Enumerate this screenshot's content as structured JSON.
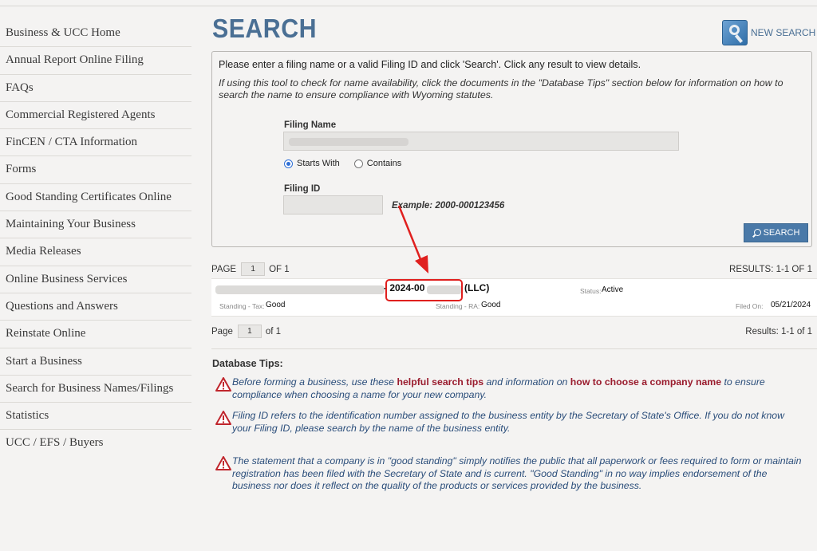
{
  "sidebar": {
    "items": [
      {
        "label": "Business & UCC Home"
      },
      {
        "label": "Annual Report Online Filing"
      },
      {
        "label": "FAQs"
      },
      {
        "label": "Commercial Registered Agents"
      },
      {
        "label": "FinCEN / CTA Information"
      },
      {
        "label": "Forms"
      },
      {
        "label": "Good Standing Certificates Online"
      },
      {
        "label": "Maintaining Your Business"
      },
      {
        "label": "Media Releases"
      },
      {
        "label": "Online Business Services"
      },
      {
        "label": "Questions and Answers"
      },
      {
        "label": "Reinstate Online"
      },
      {
        "label": "Start a Business"
      },
      {
        "label": "Search for Business Names/Filings"
      },
      {
        "label": "Statistics"
      },
      {
        "label": "UCC / EFS / Buyers"
      }
    ]
  },
  "header": {
    "title": "SEARCH",
    "new_search_label": "NEW SEARCH"
  },
  "search_form": {
    "instruction": "Please enter a filing name or a valid Filing ID and click 'Search'. Click any result to view details.",
    "note": "If using this tool to check for name availability, click the documents in the \"Database Tips\" section below for information on how to search the name to ensure compliance with Wyoming statutes.",
    "filing_name_label": "Filing Name",
    "filing_name_value": "",
    "match_options": [
      {
        "label": "Starts With",
        "checked": true
      },
      {
        "label": "Contains",
        "checked": false
      }
    ],
    "filing_id_label": "Filing ID",
    "filing_id_value": "",
    "example_text": "Example: 2000-000123456",
    "search_button_label": "SEARCH"
  },
  "pager_top": {
    "page_label": "PAGE",
    "page_value": "1",
    "of_label": "OF 1",
    "results_label": "RESULTS: 1-1 OF 1"
  },
  "result": {
    "filing_id_visible": "- 2024-00",
    "suffix": "(LLC)",
    "status_label": "Status:",
    "status_value": "Active",
    "standing_tax_label": "Standing - Tax:",
    "standing_tax_value": "Good",
    "standing_ra_label": "Standing - RA:",
    "standing_ra_value": "Good",
    "filed_on_label": "Filed On:",
    "filed_on_value": "05/21/2024"
  },
  "pager_bottom": {
    "page_label": "Page",
    "page_value": "1",
    "of_label": "of 1",
    "results_label": "Results: 1-1 of 1"
  },
  "tips": {
    "title": "Database Tips:",
    "tip1": {
      "part1": "Before forming a business, use these ",
      "link1": "helpful search tips",
      "part2": " and information on ",
      "link2": "how to choose a company name",
      "part3": " to ensure compliance when choosing a name for your new company."
    },
    "tip2": "Filing ID refers to the identification number assigned to the business entity by the Secretary of State's Office. If you do not know your Filing ID, please search by the name of the business entity.",
    "tip3": "The statement that a company is in \"good standing\" simply notifies the public that all paperwork or fees required to form or maintain registration has been filed with the Secretary of State and is current. \"Good Standing\" in no way implies endorsement of the business nor does it reflect on the quality of the products or services provided by the business."
  },
  "colors": {
    "accent": "#4a6f94",
    "link_red": "#9a1c2e",
    "tip_blue": "#2a4d7a",
    "annotation_red": "#e0201f"
  }
}
